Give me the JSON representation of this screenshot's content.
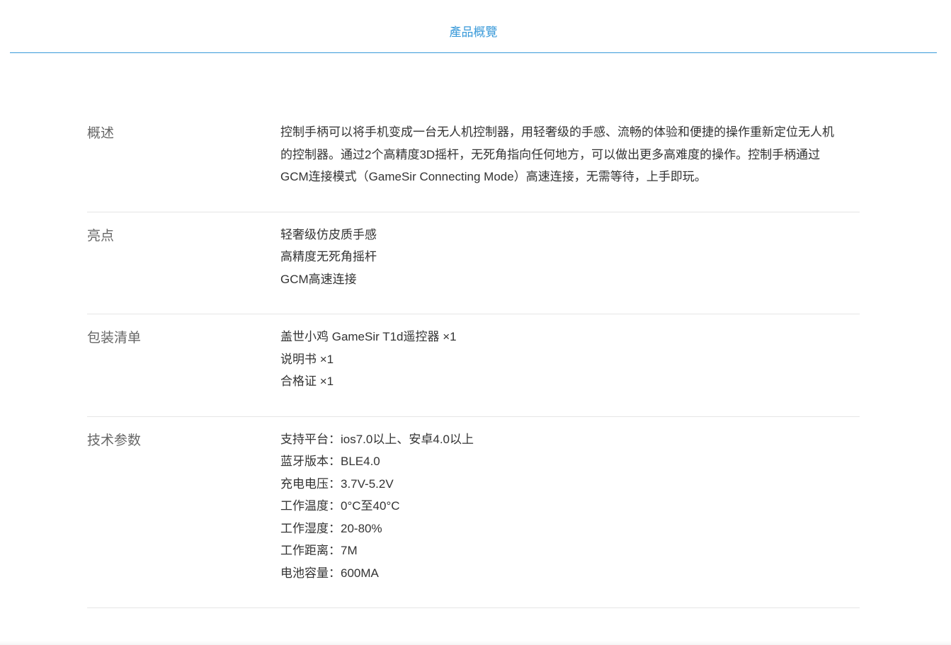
{
  "tab": {
    "label": "產品概覽"
  },
  "sections": {
    "overview": {
      "label": "概述",
      "lines": [
        "控制手柄可以将手机变成一台无人机控制器，用轻奢级的手感、流畅的体验和便捷的操作重新定位无人机",
        "的控制器。通过2个高精度3D摇杆，无死角指向任何地方，可以做出更多高难度的操作。控制手柄通过",
        "GCM连接模式（GameSir Connecting Mode）高速连接，无需等待，上手即玩。"
      ]
    },
    "highlights": {
      "label": "亮点",
      "lines": [
        "轻奢级仿皮质手感",
        "高精度无死角摇杆",
        "GCM高速连接"
      ]
    },
    "package": {
      "label": "包装清单",
      "lines": [
        "盖世小鸡 GameSir T1d遥控器 ×1",
        "说明书 ×1",
        "合格证 ×1"
      ]
    },
    "specs": {
      "label": "技术参数",
      "lines": [
        "支持平台：ios7.0以上、安卓4.0以上",
        "蓝牙版本：BLE4.0",
        "充电电压：3.7V-5.2V",
        "工作温度：0°C至40°C",
        "工作湿度：20-80%",
        "工作距离：7M",
        "电池容量：600MA"
      ]
    }
  },
  "colors": {
    "accent": "#3a9ad9",
    "label": "#666666",
    "text": "#333333",
    "divider": "#e5e5e5"
  }
}
